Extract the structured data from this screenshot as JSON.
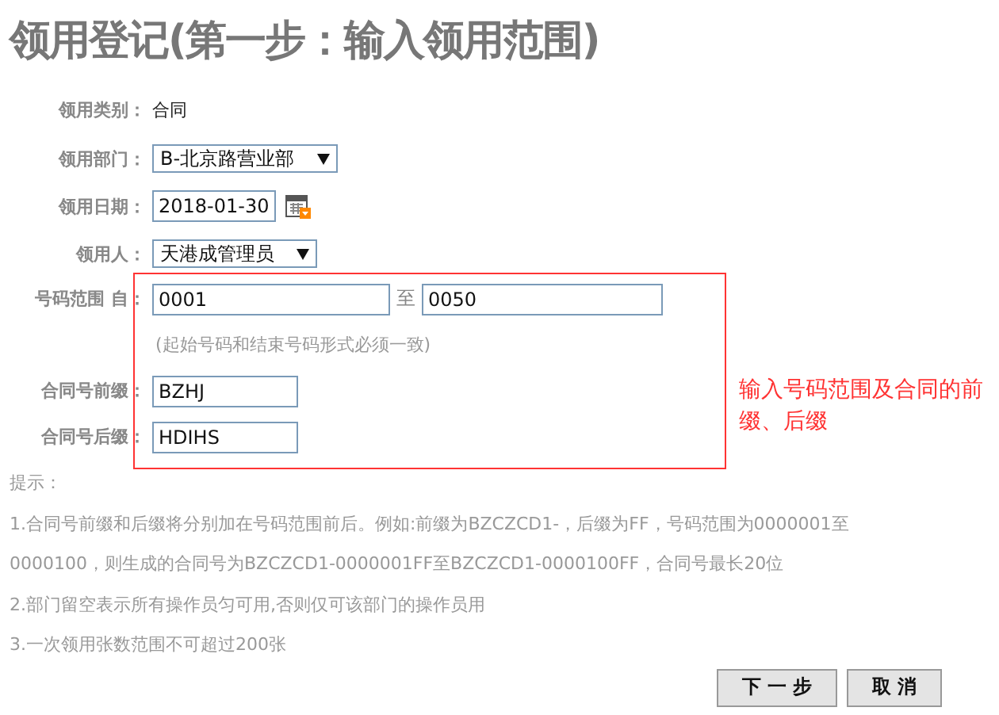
{
  "title": "领用登记(第一步：输入领用范围)",
  "fields": [
    {
      "kind": "text",
      "label": "领用类别：",
      "value": "合同"
    },
    {
      "kind": "select",
      "label": "领用部门：",
      "value": "B-北京路营业部"
    },
    {
      "kind": "date",
      "label": "领用日期：",
      "value": "2018-01-30"
    },
    {
      "kind": "select",
      "label": "领用人：",
      "value": "天港成管理员"
    },
    {
      "kind": "range",
      "label": "号码范围 自：",
      "value": "0001",
      "separator": "至",
      "value_to": "0050",
      "hint": "(起始号码和结束号码形式必须一致)"
    },
    {
      "kind": "input",
      "label": "合同号前缀：",
      "value": "BZHJ"
    },
    {
      "kind": "input",
      "label": "合同号后缀：",
      "value": "HDIHS"
    }
  ],
  "annotation": {
    "text": "输入号码范围及合同的前缀、后缀"
  },
  "tips": [
    "提示：",
    "1.合同号前缀和后缀将分别加在号码范围前后。例如:前缀为BZCZCD1-，后缀为FF，号码范围为0000001至",
    "0000100，则生成的合同号为BZCZCD1-0000001FF至BZCZCD1-0000100FF，合同号最长20位",
    "2.部门留空表示所有操作员匀可用,否则仅可该部门的操作员用",
    "3.一次领用张数范围不可超过200张"
  ],
  "buttons": [
    "下 一 步",
    "取 消"
  ]
}
